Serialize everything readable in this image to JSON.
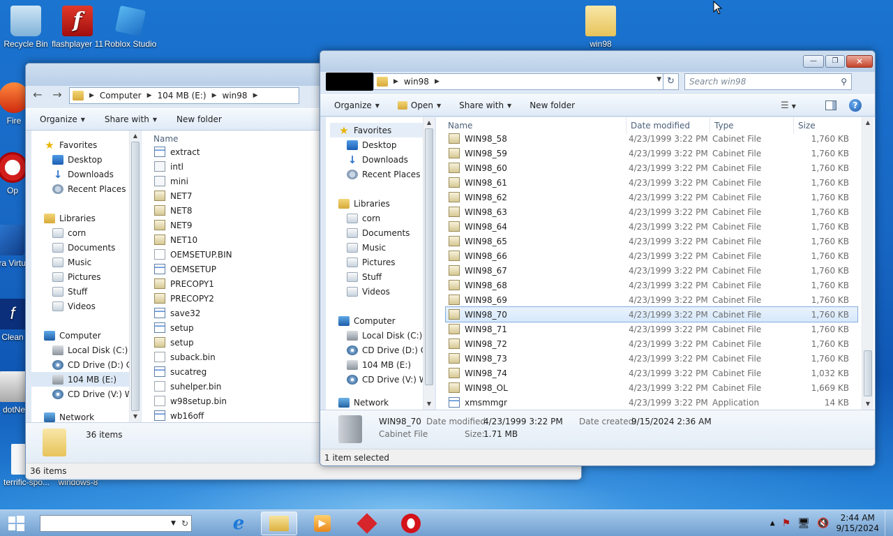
{
  "desktop": {
    "icons": [
      {
        "label": "Recycle Bin"
      },
      {
        "label": "flashplayer 11"
      },
      {
        "label": "Roblox Studio"
      },
      {
        "label": "win98"
      },
      {
        "label": "Fire"
      },
      {
        "label": "Op"
      },
      {
        "label": "Ora Virtu"
      },
      {
        "label": "Clean"
      },
      {
        "label": "dotNe"
      },
      {
        "label": "terrific-spo..."
      },
      {
        "label": "windows-8"
      }
    ]
  },
  "back_window": {
    "address": {
      "crumbs": [
        "Computer",
        "104 MB (E:)",
        "win98"
      ]
    },
    "toolbar": {
      "organize": "Organize",
      "share": "Share with",
      "new_folder": "New folder"
    },
    "nav": {
      "favorites": "Favorites",
      "fav_items": [
        "Desktop",
        "Downloads",
        "Recent Places"
      ],
      "libraries": "Libraries",
      "lib_items": [
        "corn",
        "Documents",
        "Music",
        "Pictures",
        "Stuff",
        "Videos"
      ],
      "computer": "Computer",
      "comp_items": [
        "Local Disk (C:)",
        "CD Drive (D:) CC",
        "104 MB (E:)",
        "CD Drive (V:) Wir"
      ],
      "network": "Network"
    },
    "column_name": "Name",
    "files": [
      "extract",
      "intl",
      "mini",
      "NET7",
      "NET8",
      "NET9",
      "NET10",
      "OEMSETUP.BIN",
      "OEMSETUP",
      "PRECOPY1",
      "PRECOPY2",
      "save32",
      "setup",
      "setup",
      "suback.bin",
      "sucatreg",
      "suhelper.bin",
      "w98setup.bin",
      "wb16off"
    ],
    "details_count": "36 items",
    "status": "36 items"
  },
  "front_window": {
    "address": {
      "crumbs": [
        "win98"
      ]
    },
    "search_placeholder": "Search win98",
    "toolbar": {
      "organize": "Organize",
      "open": "Open",
      "share": "Share with",
      "new_folder": "New folder"
    },
    "nav": {
      "favorites": "Favorites",
      "fav_items": [
        "Desktop",
        "Downloads",
        "Recent Places"
      ],
      "libraries": "Libraries",
      "lib_items": [
        "corn",
        "Documents",
        "Music",
        "Pictures",
        "Stuff",
        "Videos"
      ],
      "computer": "Computer",
      "comp_items": [
        "Local Disk (C:)",
        "CD Drive (D:) CC",
        "104 MB (E:)",
        "CD Drive (V:) Wir"
      ],
      "network": "Network"
    },
    "columns": {
      "name": "Name",
      "date": "Date modified",
      "type": "Type",
      "size": "Size"
    },
    "files": [
      {
        "name": "WIN98_58",
        "date": "4/23/1999 3:22 PM",
        "type": "Cabinet File",
        "size": "1,760 KB"
      },
      {
        "name": "WIN98_59",
        "date": "4/23/1999 3:22 PM",
        "type": "Cabinet File",
        "size": "1,760 KB"
      },
      {
        "name": "WIN98_60",
        "date": "4/23/1999 3:22 PM",
        "type": "Cabinet File",
        "size": "1,760 KB"
      },
      {
        "name": "WIN98_61",
        "date": "4/23/1999 3:22 PM",
        "type": "Cabinet File",
        "size": "1,760 KB"
      },
      {
        "name": "WIN98_62",
        "date": "4/23/1999 3:22 PM",
        "type": "Cabinet File",
        "size": "1,760 KB"
      },
      {
        "name": "WIN98_63",
        "date": "4/23/1999 3:22 PM",
        "type": "Cabinet File",
        "size": "1,760 KB"
      },
      {
        "name": "WIN98_64",
        "date": "4/23/1999 3:22 PM",
        "type": "Cabinet File",
        "size": "1,760 KB"
      },
      {
        "name": "WIN98_65",
        "date": "4/23/1999 3:22 PM",
        "type": "Cabinet File",
        "size": "1,760 KB"
      },
      {
        "name": "WIN98_66",
        "date": "4/23/1999 3:22 PM",
        "type": "Cabinet File",
        "size": "1,760 KB"
      },
      {
        "name": "WIN98_67",
        "date": "4/23/1999 3:22 PM",
        "type": "Cabinet File",
        "size": "1,760 KB"
      },
      {
        "name": "WIN98_68",
        "date": "4/23/1999 3:22 PM",
        "type": "Cabinet File",
        "size": "1,760 KB"
      },
      {
        "name": "WIN98_69",
        "date": "4/23/1999 3:22 PM",
        "type": "Cabinet File",
        "size": "1,760 KB"
      },
      {
        "name": "WIN98_70",
        "date": "4/23/1999 3:22 PM",
        "type": "Cabinet File",
        "size": "1,760 KB"
      },
      {
        "name": "WIN98_71",
        "date": "4/23/1999 3:22 PM",
        "type": "Cabinet File",
        "size": "1,760 KB"
      },
      {
        "name": "WIN98_72",
        "date": "4/23/1999 3:22 PM",
        "type": "Cabinet File",
        "size": "1,760 KB"
      },
      {
        "name": "WIN98_73",
        "date": "4/23/1999 3:22 PM",
        "type": "Cabinet File",
        "size": "1,760 KB"
      },
      {
        "name": "WIN98_74",
        "date": "4/23/1999 3:22 PM",
        "type": "Cabinet File",
        "size": "1,032 KB"
      },
      {
        "name": "WIN98_OL",
        "date": "4/23/1999 3:22 PM",
        "type": "Cabinet File",
        "size": "1,669 KB"
      },
      {
        "name": "xmsmmgr",
        "date": "4/23/1999 3:22 PM",
        "type": "Application",
        "size": "14 KB"
      }
    ],
    "selected_index": 12,
    "details": {
      "name": "WIN98_70",
      "type": "Cabinet File",
      "modified_label": "Date modified:",
      "modified_value": "4/23/1999 3:22 PM",
      "created_label": "Date created:",
      "created_value": "9/15/2024 2:36 AM",
      "size_label": "Size:",
      "size_value": "1.71 MB"
    },
    "status": "1 item selected"
  },
  "taskbar": {
    "time": "2:44 AM",
    "date": "9/15/2024",
    "tray_chevron": "▲"
  },
  "colors": {
    "selection": "#d6e8fb",
    "accent": "#1766c3"
  }
}
